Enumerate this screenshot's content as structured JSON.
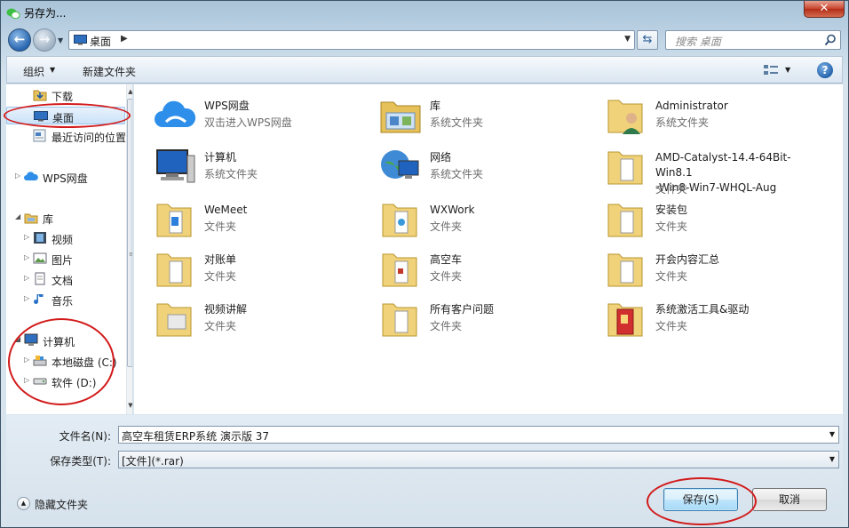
{
  "window": {
    "title": "另存为...",
    "close_label": "✕"
  },
  "address": {
    "location": "桌面",
    "search_placeholder": "搜索 桌面"
  },
  "toolbar": {
    "organize": "组织",
    "new_folder": "新建文件夹",
    "help": "?"
  },
  "nav": {
    "items": [
      {
        "label": "下载",
        "icon": "downloads-icon"
      },
      {
        "label": "桌面",
        "icon": "desktop-icon",
        "selected": true
      },
      {
        "label": "最近访问的位置",
        "icon": "recent-places-icon"
      },
      {
        "label": "WPS网盘",
        "icon": "cloud-icon"
      },
      {
        "label": "库",
        "icon": "library-icon"
      },
      {
        "label": "视频",
        "icon": "video-icon"
      },
      {
        "label": "图片",
        "icon": "pictures-icon"
      },
      {
        "label": "文档",
        "icon": "documents-icon"
      },
      {
        "label": "音乐",
        "icon": "music-icon"
      },
      {
        "label": "计算机",
        "icon": "computer-icon"
      },
      {
        "label": "本地磁盘 (C:)",
        "icon": "local-disk-icon"
      },
      {
        "label": "软件 (D:)",
        "icon": "drive-icon"
      }
    ]
  },
  "files": [
    {
      "name": "WPS网盘",
      "type": "双击进入WPS网盘",
      "icon": "cloud-icon"
    },
    {
      "name": "库",
      "type": "系统文件夹",
      "icon": "library-icon"
    },
    {
      "name": "Administrator",
      "type": "系统文件夹",
      "icon": "user-folder-icon"
    },
    {
      "name": "计算机",
      "type": "系统文件夹",
      "icon": "computer-icon"
    },
    {
      "name": "网络",
      "type": "系统文件夹",
      "icon": "network-icon"
    },
    {
      "name": "AMD-Catalyst-14.4-64Bit-Win8.1",
      "name2": "-Win8-Win7-WHQL-Aug",
      "type": "文件夹",
      "icon": "folder-icon"
    },
    {
      "name": "WeMeet",
      "type": "文件夹",
      "icon": "folder-icon"
    },
    {
      "name": "WXWork",
      "type": "文件夹",
      "icon": "folder-icon"
    },
    {
      "name": "安装包",
      "type": "文件夹",
      "icon": "folder-icon"
    },
    {
      "name": "对账单",
      "type": "文件夹",
      "icon": "folder-icon"
    },
    {
      "name": "高空车",
      "type": "文件夹",
      "icon": "folder-icon"
    },
    {
      "name": "开会内容汇总",
      "type": "文件夹",
      "icon": "folder-icon"
    },
    {
      "name": "视频讲解",
      "type": "文件夹",
      "icon": "folder-icon"
    },
    {
      "name": "所有客户问题",
      "type": "文件夹",
      "icon": "folder-icon"
    },
    {
      "name": "系统激活工具&驱动",
      "type": "文件夹",
      "icon": "folder-icon"
    }
  ],
  "form": {
    "filename_label": "文件名(N):",
    "filename_value": "高空车租赁ERP系统 演示版 37",
    "filetype_label": "保存类型(T):",
    "filetype_value": "[文件](*.rar)",
    "hide_folders": "隐藏文件夹",
    "save": "保存(S)",
    "cancel": "取消"
  },
  "colors": {
    "annotation": "#d21a1a",
    "selection": "#cbe2f8"
  }
}
